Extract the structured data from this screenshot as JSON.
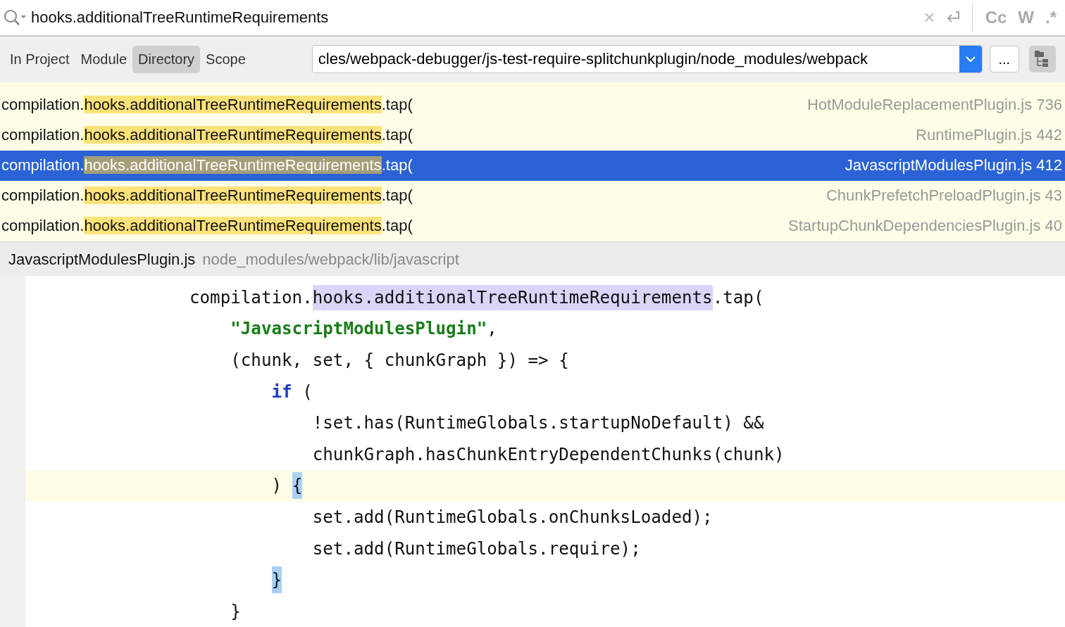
{
  "search": {
    "value": "hooks.additionalTreeRuntimeRequirements",
    "clear": "×",
    "toggles": [
      {
        "label": "Cc",
        "selected": false
      },
      {
        "label": "W",
        "selected": false
      },
      {
        "label": ".*",
        "selected": false
      }
    ]
  },
  "scope_tabs": [
    {
      "label": "In Project",
      "selected": false
    },
    {
      "label": "Module",
      "selected": false
    },
    {
      "label": "Directory",
      "selected": true
    },
    {
      "label": "Scope",
      "selected": false
    }
  ],
  "directory": {
    "value": "cles/webpack-debugger/js-test-require-splitchunkplugin/node_modules/webpack",
    "browse": "..."
  },
  "results": [
    {
      "prefix": "compilation.",
      "match": "hooks.additionalTreeRuntimeRequirements",
      "suffix": ".tap(",
      "file": "HotModuleReplacementPlugin.js 736",
      "selected": false
    },
    {
      "prefix": "compilation.",
      "match": "hooks.additionalTreeRuntimeRequirements",
      "suffix": ".tap(",
      "file": "RuntimePlugin.js 442",
      "selected": false
    },
    {
      "prefix": "compilation.",
      "match": "hooks.additionalTreeRuntimeRequirements",
      "suffix": ".tap(",
      "file": "JavascriptModulesPlugin.js 412",
      "selected": true
    },
    {
      "prefix": "compilation.",
      "match": "hooks.additionalTreeRuntimeRequirements",
      "suffix": ".tap(",
      "file": "ChunkPrefetchPreloadPlugin.js 43",
      "selected": false
    },
    {
      "prefix": "compilation.",
      "match": "hooks.additionalTreeRuntimeRequirements",
      "suffix": ".tap(",
      "file": "StartupChunkDependenciesPlugin.js 40",
      "selected": false
    }
  ],
  "preview": {
    "file": "JavascriptModulesPlugin.js",
    "path": "node_modules/webpack/lib/javascript",
    "lines": [
      {
        "current": false,
        "tokens": [
          {
            "kind": "plain",
            "text": "                compilation."
          },
          {
            "kind": "match",
            "text": "hooks.additionalTreeRuntimeRequirements"
          },
          {
            "kind": "plain",
            "text": ".tap("
          }
        ]
      },
      {
        "current": false,
        "tokens": [
          {
            "kind": "string",
            "text": "                    \"JavascriptModulesPlugin\""
          },
          {
            "kind": "plain",
            "text": ","
          }
        ]
      },
      {
        "current": false,
        "tokens": [
          {
            "kind": "plain",
            "text": "                    (chunk, set, { chunkGraph }) => {"
          }
        ]
      },
      {
        "current": false,
        "tokens": [
          {
            "kind": "keyword",
            "text": "                        if"
          },
          {
            "kind": "plain",
            "text": " ("
          }
        ]
      },
      {
        "current": false,
        "tokens": [
          {
            "kind": "plain",
            "text": "                            !set.has(RuntimeGlobals.startupNoDefault) &&"
          }
        ]
      },
      {
        "current": false,
        "tokens": [
          {
            "kind": "plain",
            "text": "                            chunkGraph.hasChunkEntryDependentChunks(chunk)"
          }
        ]
      },
      {
        "current": true,
        "tokens": [
          {
            "kind": "plain",
            "text": "                        ) "
          },
          {
            "kind": "brace",
            "text": "{"
          }
        ]
      },
      {
        "current": false,
        "tokens": [
          {
            "kind": "plain",
            "text": "                            set.add(RuntimeGlobals.onChunksLoaded);"
          }
        ]
      },
      {
        "current": false,
        "tokens": [
          {
            "kind": "plain",
            "text": "                            set.add(RuntimeGlobals.require);"
          }
        ]
      },
      {
        "current": false,
        "tokens": [
          {
            "kind": "brace",
            "text": "                        }"
          }
        ]
      },
      {
        "current": false,
        "tokens": [
          {
            "kind": "plain",
            "text": "                    }"
          }
        ]
      }
    ]
  }
}
